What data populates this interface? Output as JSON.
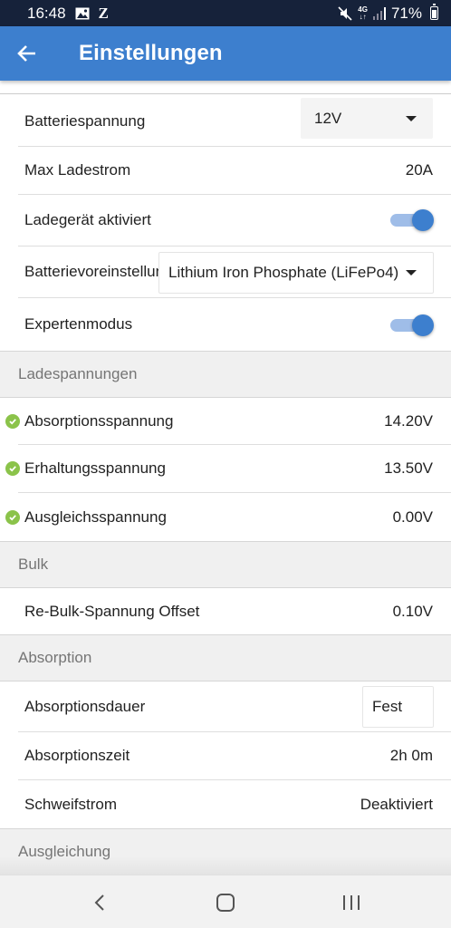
{
  "status_bar": {
    "time": "16:48",
    "network_label": "4G",
    "battery_percent": "71%",
    "icons": [
      "image-icon",
      "z-icon",
      "mute-icon",
      "4g-icon",
      "signal-icon",
      "battery-icon"
    ]
  },
  "app_bar": {
    "title": "Einstellungen",
    "back_icon": "arrow-left-icon"
  },
  "settings": {
    "battery_voltage": {
      "label": "Batteriespannung",
      "value": "12V"
    },
    "max_charge_current": {
      "label": "Max Ladestrom",
      "value": "20A"
    },
    "charger_enabled": {
      "label": "Ladegerät aktiviert",
      "on": true
    },
    "battery_preset": {
      "label": "Batterievoreinstellung",
      "value": "Lithium Iron Phosphate (LiFePo4)"
    },
    "expert_mode": {
      "label": "Expertenmodus",
      "on": true
    }
  },
  "sections": {
    "charge_voltages": {
      "title": "Ladespannungen",
      "rows": [
        {
          "label": "Absorptionsspannung",
          "value": "14.20V"
        },
        {
          "label": "Erhaltungsspannung",
          "value": "13.50V"
        },
        {
          "label": "Ausgleichsspannung",
          "value": "0.00V"
        }
      ]
    },
    "bulk": {
      "title": "Bulk",
      "rows": [
        {
          "label": "Re-Bulk-Spannung Offset",
          "value": "0.10V"
        }
      ]
    },
    "absorption": {
      "title": "Absorption",
      "rows": [
        {
          "label": "Absorptionsdauer",
          "value": "Fest"
        },
        {
          "label": "Absorptionszeit",
          "value": "2h 0m"
        },
        {
          "label": "Schweifstrom",
          "value": "Deaktiviert"
        }
      ]
    },
    "equalization": {
      "title": "Ausgleichung"
    }
  },
  "colors": {
    "app_bar": "#3d7fce",
    "status_bar": "#16223a",
    "toggle_on": "#3d7fce",
    "check_green": "#8bc34a"
  },
  "nav_bar": {
    "back_icon": "chevron-left-icon",
    "home_icon": "home-icon",
    "recents_icon": "recents-icon"
  }
}
